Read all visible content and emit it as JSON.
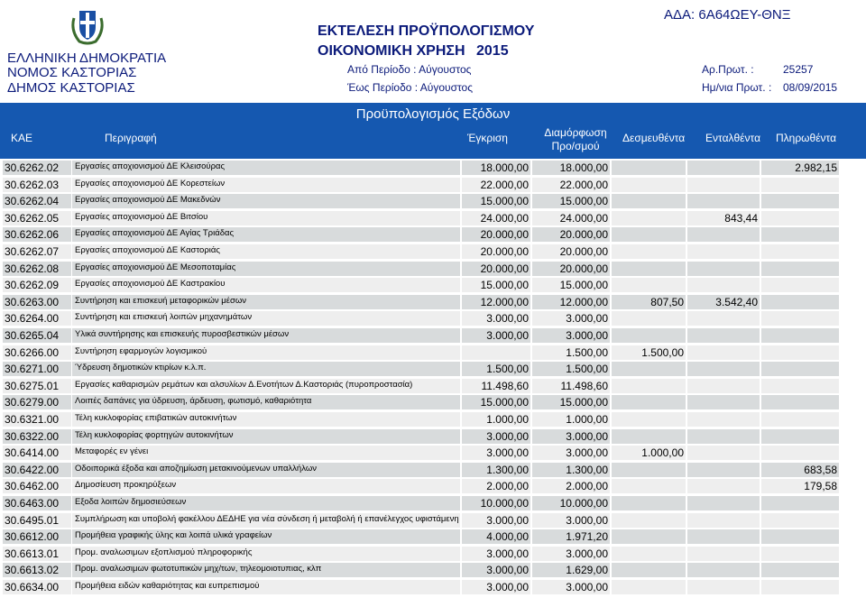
{
  "header": {
    "left_lines": [
      "ΕΛΛΗΝΙΚΗ ΔΗΜΟΚΡΑΤΙΑ",
      "ΝΟΜΟΣ ΚΑΣΤΟΡΙΑΣ",
      "ΔΗΜΟΣ ΚΑΣΤΟΡΙΑΣ"
    ],
    "title_line1": "ΕΚΤΕΛΕΣΗ ΠΡΟΫΠΟΛΟΓΙΣΜΟΥ",
    "title_line2": "ΟΙΚΟΝΟΜΙΚΗ ΧΡΗΣΗ",
    "year": "2015",
    "period_from": "Από Περίοδο : Αύγουστος",
    "period_to": "Έως Περίοδο : Αύγουστος",
    "ada": "ΑΔΑ: 6Α64ΩΕΥ-ΘΝΞ",
    "protocol_label": "Αρ.Πρωτ. :",
    "protocol_value": "25257",
    "protocol_date_label": "Ημ/νια Πρωτ. :",
    "protocol_date_value": "08/09/2015",
    "emblem_icon": "greek-coat-of-arms-icon"
  },
  "table": {
    "section_title": "Προϋπολογισμός Εξόδων",
    "columns": {
      "kae": "ΚΑΕ",
      "description": "Περιγραφή",
      "approval": "Έγκριση",
      "formation_line1": "Διαμόρφωση",
      "formation_line2": "Προ/σμού",
      "committed": "Δεσμευθέντα",
      "certified": "Ενταλθέντα",
      "paid": "Πληρωθέντα"
    },
    "rows": [
      {
        "kae": "30.6262.02",
        "desc": "Εργασίες αποχιονισμού ΔΕ Κλεισούρας",
        "approval": "18.000,00",
        "formation": "18.000,00",
        "committed": "",
        "certified": "",
        "paid": "2.982,15"
      },
      {
        "kae": "30.6262.03",
        "desc": "Εργασίες αποχιονισμού ΔΕ Κορεστείων",
        "approval": "22.000,00",
        "formation": "22.000,00",
        "committed": "",
        "certified": "",
        "paid": ""
      },
      {
        "kae": "30.6262.04",
        "desc": "Εργασίες αποχιονισμού ΔΕ Μακεδνών",
        "approval": "15.000,00",
        "formation": "15.000,00",
        "committed": "",
        "certified": "",
        "paid": ""
      },
      {
        "kae": "30.6262.05",
        "desc": "Εργασίες αποχιονισμού ΔΕ Βιτσίου",
        "approval": "24.000,00",
        "formation": "24.000,00",
        "committed": "",
        "certified": "843,44",
        "paid": ""
      },
      {
        "kae": "30.6262.06",
        "desc": "Εργασίες αποχιονισμού ΔΕ Αγίας Τριάδας",
        "approval": "20.000,00",
        "formation": "20.000,00",
        "committed": "",
        "certified": "",
        "paid": ""
      },
      {
        "kae": "30.6262.07",
        "desc": "Εργασίες αποχιονισμού ΔΕ Καστοριάς",
        "approval": "20.000,00",
        "formation": "20.000,00",
        "committed": "",
        "certified": "",
        "paid": ""
      },
      {
        "kae": "30.6262.08",
        "desc": "Εργασίες αποχιονισμού ΔΕ Μεσοποταμίας",
        "approval": "20.000,00",
        "formation": "20.000,00",
        "committed": "",
        "certified": "",
        "paid": ""
      },
      {
        "kae": "30.6262.09",
        "desc": "Εργασίες αποχιονισμού ΔΕ Καστρακίου",
        "approval": "15.000,00",
        "formation": "15.000,00",
        "committed": "",
        "certified": "",
        "paid": ""
      },
      {
        "kae": "30.6263.00",
        "desc": "Συντήρηση και επισκευή μεταφορικών μέσων",
        "approval": "12.000,00",
        "formation": "12.000,00",
        "committed": "807,50",
        "certified": "3.542,40",
        "paid": ""
      },
      {
        "kae": "30.6264.00",
        "desc": "Συντήρηση και επισκευή λοιπών μηχανημάτων",
        "approval": "3.000,00",
        "formation": "3.000,00",
        "committed": "",
        "certified": "",
        "paid": ""
      },
      {
        "kae": "30.6265.04",
        "desc": "Υλικά συντήρησης και επισκευής πυροσβεστικών μέσων",
        "approval": "3.000,00",
        "formation": "3.000,00",
        "committed": "",
        "certified": "",
        "paid": ""
      },
      {
        "kae": "30.6266.00",
        "desc": "Συντήρηση εφαρμογών λογισμικού",
        "approval": "",
        "formation": "1.500,00",
        "committed": "1.500,00",
        "certified": "",
        "paid": ""
      },
      {
        "kae": "30.6271.00",
        "desc": "Ύδρευση δημοτικών κτιρίων κ.λ.π.",
        "approval": "1.500,00",
        "formation": "1.500,00",
        "committed": "",
        "certified": "",
        "paid": ""
      },
      {
        "kae": "30.6275.01",
        "desc": "Εργασίες καθαρισμών ρεμάτων και αλσυλίων Δ.Ενοτήτων Δ.Καστοριάς (πυροπροστασία)",
        "approval": "11.498,60",
        "formation": "11.498,60",
        "committed": "",
        "certified": "",
        "paid": ""
      },
      {
        "kae": "30.6279.00",
        "desc": "Λοιπές δαπάνες για ύδρευση, άρδευση, φωτισμό, καθαριότητα",
        "approval": "15.000,00",
        "formation": "15.000,00",
        "committed": "",
        "certified": "",
        "paid": ""
      },
      {
        "kae": "30.6321.00",
        "desc": "Τέλη κυκλοφορίας επιβατικών αυτοκινήτων",
        "approval": "1.000,00",
        "formation": "1.000,00",
        "committed": "",
        "certified": "",
        "paid": ""
      },
      {
        "kae": "30.6322.00",
        "desc": "Τέλη κυκλοφορίας φορτηγών αυτοκινήτων",
        "approval": "3.000,00",
        "formation": "3.000,00",
        "committed": "",
        "certified": "",
        "paid": ""
      },
      {
        "kae": "30.6414.00",
        "desc": "Μεταφορές εν γένει",
        "approval": "3.000,00",
        "formation": "3.000,00",
        "committed": "1.000,00",
        "certified": "",
        "paid": ""
      },
      {
        "kae": "30.6422.00",
        "desc": "Οδοιπορικά έξοδα και αποζημίωση μετακινούμενων υπαλλήλων",
        "approval": "1.300,00",
        "formation": "1.300,00",
        "committed": "",
        "certified": "",
        "paid": "683,58"
      },
      {
        "kae": "30.6462.00",
        "desc": "Δημοσίευση προκηρύξεων",
        "approval": "2.000,00",
        "formation": "2.000,00",
        "committed": "",
        "certified": "",
        "paid": "179,58"
      },
      {
        "kae": "30.6463.00",
        "desc": "Εξοδα λοιπών δημοσιεύσεων",
        "approval": "10.000,00",
        "formation": "10.000,00",
        "committed": "",
        "certified": "",
        "paid": ""
      },
      {
        "kae": "30.6495.01",
        "desc": "Συμπλήρωση και υποβολή φακέλλου ΔΕΔΗΕ για νέα σύνδεση ή μεταβολή ή επανέλεγχος υφιστάμενη",
        "approval": "3.000,00",
        "formation": "3.000,00",
        "committed": "",
        "certified": "",
        "paid": ""
      },
      {
        "kae": "30.6612.00",
        "desc": "Προμήθεια γραφικής ύλης και λοιπά υλικά γραφείων",
        "approval": "4.000,00",
        "formation": "1.971,20",
        "committed": "",
        "certified": "",
        "paid": ""
      },
      {
        "kae": "30.6613.01",
        "desc": "Προμ. αναλωσιμων εξοπλισμού πληροφορικής",
        "approval": "3.000,00",
        "formation": "3.000,00",
        "committed": "",
        "certified": "",
        "paid": ""
      },
      {
        "kae": "30.6613.02",
        "desc": "Προμ. αναλωσιμων φωτοτυπικών μηχ/των, τηλεομοιοτυπιας, κλπ",
        "approval": "3.000,00",
        "formation": "1.629,00",
        "committed": "",
        "certified": "",
        "paid": ""
      },
      {
        "kae": "30.6634.00",
        "desc": "Προμήθεια ειδών καθαριότητας και ευπρεπισμού",
        "approval": "3.000,00",
        "formation": "3.000,00",
        "committed": "",
        "certified": "",
        "paid": ""
      }
    ]
  }
}
